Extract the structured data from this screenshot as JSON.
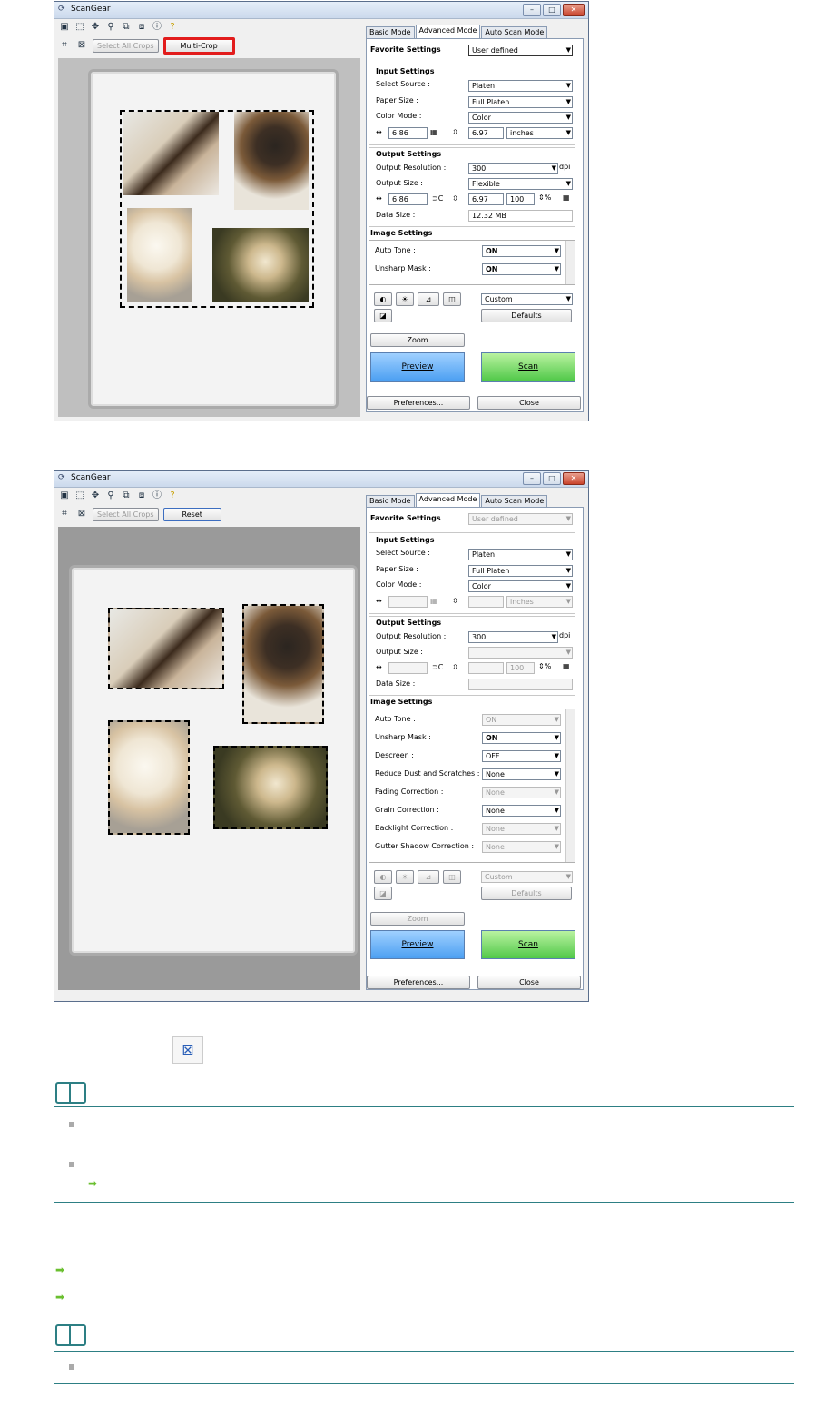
{
  "window_title": "ScanGear",
  "screenshot1": {
    "toolbar2": {
      "select_all": "Select All Crops",
      "multi_crop": "Multi-Crop"
    },
    "tabs": [
      "Basic Mode",
      "Advanced Mode",
      "Auto Scan Mode"
    ],
    "favorite": {
      "label": "Favorite Settings",
      "value": "User defined"
    },
    "input": {
      "header": "Input Settings",
      "source_label": "Select Source :",
      "source": "Platen",
      "paper_label": "Paper Size :",
      "paper": "Full Platen",
      "color_label": "Color Mode :",
      "color": "Color",
      "width": "6.86",
      "height": "6.97",
      "units": "inches"
    },
    "output": {
      "header": "Output Settings",
      "res_label": "Output Resolution :",
      "res": "300",
      "dpi": "dpi",
      "size_label": "Output Size :",
      "size": "Flexible",
      "width": "6.86",
      "height": "6.97",
      "pct": "100",
      "datasize_label": "Data Size :",
      "datasize": "12.32 MB"
    },
    "image": {
      "header": "Image Settings",
      "rows": [
        {
          "label": "Auto Tone :",
          "value": "ON"
        },
        {
          "label": "Unsharp Mask :",
          "value": "ON"
        }
      ]
    },
    "custom": "Custom",
    "defaults": "Defaults",
    "zoom": "Zoom",
    "preview": "Preview",
    "scan": "Scan",
    "preferences": "Preferences...",
    "close": "Close"
  },
  "screenshot2": {
    "toolbar2": {
      "select_all": "Select All Crops",
      "reset": "Reset"
    },
    "tabs": [
      "Basic Mode",
      "Advanced Mode",
      "Auto Scan Mode"
    ],
    "favorite": {
      "label": "Favorite Settings",
      "value": "User defined"
    },
    "input": {
      "header": "Input Settings",
      "source_label": "Select Source :",
      "source": "Platen",
      "paper_label": "Paper Size :",
      "paper": "Full Platen",
      "color_label": "Color Mode :",
      "color": "Color",
      "units": "inches"
    },
    "output": {
      "header": "Output Settings",
      "res_label": "Output Resolution :",
      "res": "300",
      "dpi": "dpi",
      "size_label": "Output Size :",
      "pct": "100",
      "datasize_label": "Data Size :"
    },
    "image": {
      "header": "Image Settings",
      "rows": [
        {
          "label": "Auto Tone :",
          "value": "ON"
        },
        {
          "label": "Unsharp Mask :",
          "value": "ON"
        },
        {
          "label": "Descreen :",
          "value": "OFF"
        },
        {
          "label": "Reduce Dust and Scratches :",
          "value": "None"
        },
        {
          "label": "Fading Correction :",
          "value": "None"
        },
        {
          "label": "Grain Correction :",
          "value": "None"
        },
        {
          "label": "Backlight Correction :",
          "value": "None"
        },
        {
          "label": "Gutter Shadow Correction :",
          "value": "None"
        }
      ]
    },
    "custom": "Custom",
    "defaults": "Defaults",
    "zoom": "Zoom",
    "preview": "Preview",
    "scan": "Scan",
    "preferences": "Preferences...",
    "close": "Close"
  }
}
